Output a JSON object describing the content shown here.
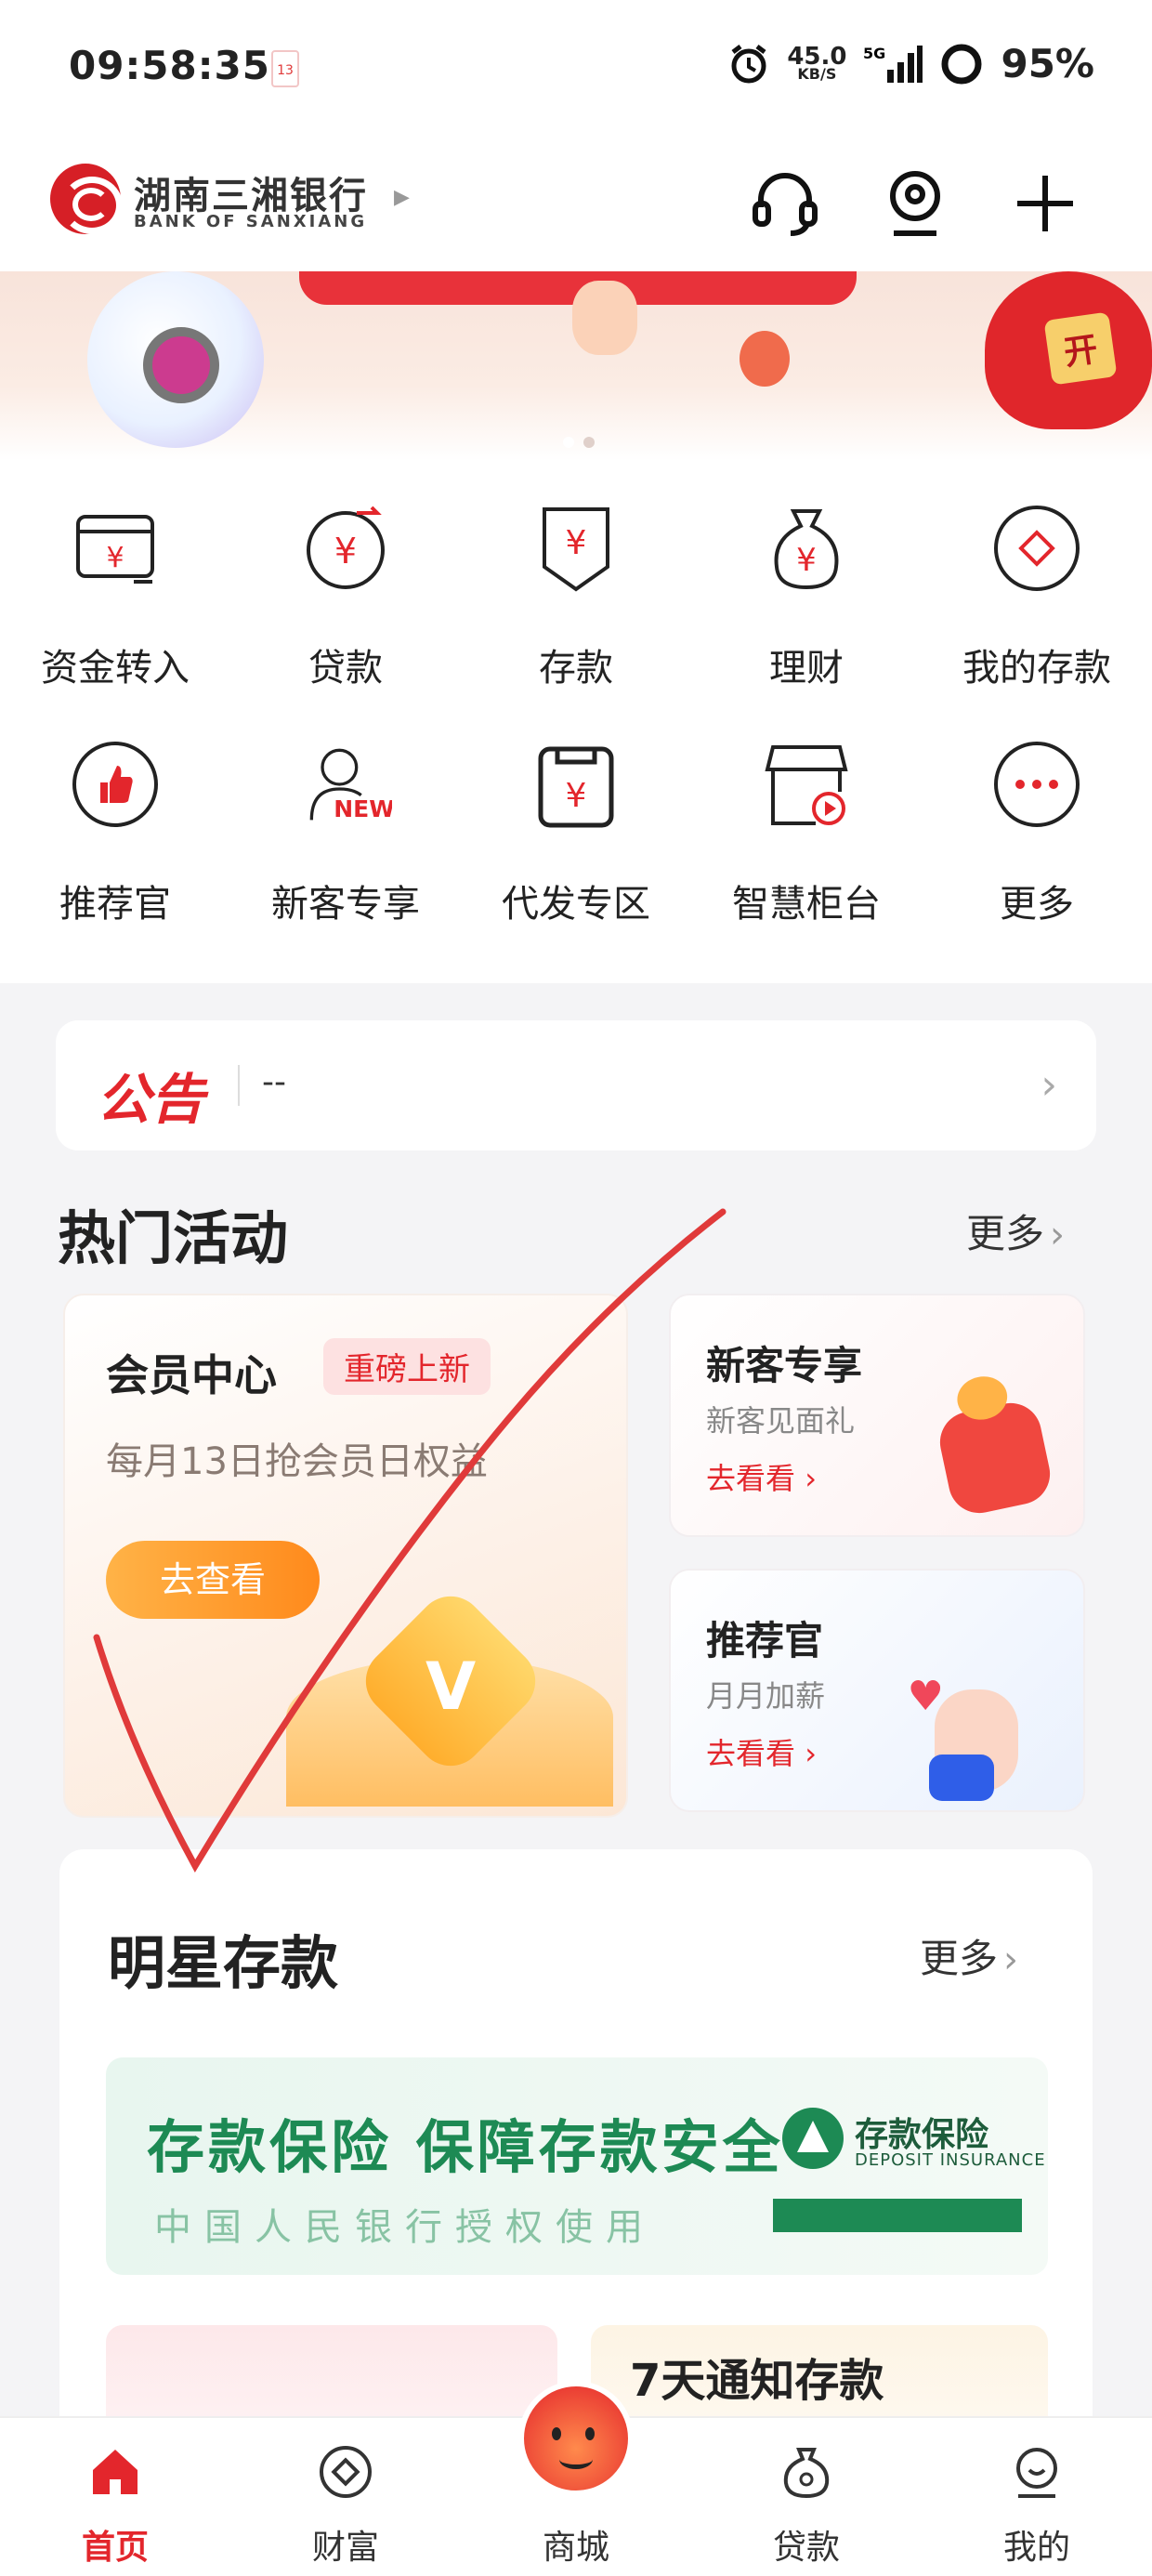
{
  "status_bar": {
    "time": "09:58:35",
    "calendar_badge": "13",
    "net_speed": "45.0",
    "net_unit": "KB/S",
    "network": "5G",
    "battery": "95%"
  },
  "header": {
    "bank_name_cn": "湖南三湘银行",
    "bank_name_en": "BANK OF SANXIANG",
    "icons": [
      "headset-icon",
      "user-icon",
      "plus-icon"
    ]
  },
  "quick_actions": [
    {
      "label": "资金转入",
      "icon": "yuan-card-icon"
    },
    {
      "label": "贷款",
      "icon": "yuan-cycle-icon"
    },
    {
      "label": "存款",
      "icon": "yuan-shield-icon"
    },
    {
      "label": "理财",
      "icon": "money-bag-icon"
    },
    {
      "label": "我的存款",
      "icon": "diamond-icon"
    },
    {
      "label": "推荐官",
      "icon": "thumbs-up-icon"
    },
    {
      "label": "新客专享",
      "icon": "new-user-icon",
      "badge": "NEW"
    },
    {
      "label": "代发专区",
      "icon": "yuan-envelope-icon"
    },
    {
      "label": "智慧柜台",
      "icon": "kiosk-icon"
    },
    {
      "label": "更多",
      "icon": "more-dots-icon"
    }
  ],
  "notice": {
    "title": "公告",
    "text": "--"
  },
  "hot": {
    "title": "热门活动",
    "more": "更多",
    "member": {
      "title": "会员中心",
      "badge": "重磅上新",
      "subtitle": "每月13日抢会员日权益",
      "button": "去查看"
    },
    "new_customer": {
      "title": "新客专享",
      "subtitle": "新客见面礼",
      "link": "去看看"
    },
    "recommender": {
      "title": "推荐官",
      "subtitle": "月月加薪",
      "link": "去看看"
    }
  },
  "star_deposit": {
    "title": "明星存款",
    "more": "更多",
    "insurance_banner": {
      "headline": "存款保险 保障存款安全",
      "sub": "中国人民银行授权使用",
      "logo_cn": "存款保险",
      "logo_en": "DEPOSIT INSURANCE"
    },
    "product_2_title": "7天通知存款"
  },
  "tabbar": [
    {
      "label": "首页",
      "icon": "home-icon",
      "active": true
    },
    {
      "label": "财富",
      "icon": "wealth-icon",
      "active": false
    },
    {
      "label": "商城",
      "icon": "mascot-icon",
      "active": false
    },
    {
      "label": "贷款",
      "icon": "loan-bag-icon",
      "active": false
    },
    {
      "label": "我的",
      "icon": "profile-icon",
      "active": false
    }
  ],
  "colors": {
    "brand_red": "#e3262c",
    "insurance_green": "#1d8a54",
    "annotation_red": "#e03a3a"
  }
}
